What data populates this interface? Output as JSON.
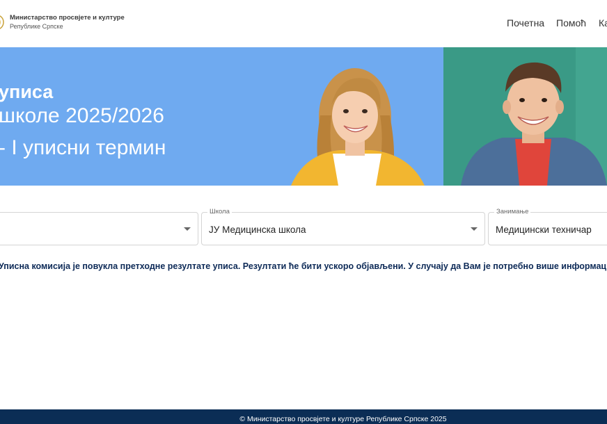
{
  "header": {
    "logo_line1": "Министарство просвјете и културе",
    "logo_line2": "Републике Српске",
    "nav": {
      "home": "Почетна",
      "help": "Помоћ",
      "third": "Ка"
    }
  },
  "hero": {
    "title_line1": "уписа",
    "title_line2": "школе 2025/2026",
    "title_line3": "- I уписни термин"
  },
  "filters": {
    "school": {
      "label": "Школа",
      "value": "ЈУ Медицинска школа"
    },
    "occupation": {
      "label": "Занимање",
      "value": "Медицински техничар"
    }
  },
  "notice": "Уписна комисија је повукла претходне резултате уписа. Резултати ће бити ускоро објављени. У случају да Вам је потребно више информација, ко",
  "footer": {
    "copyright": "© Министарство просвјете и културе Републике Српске 2025"
  },
  "colors": {
    "hero_blue": "#6faaf0",
    "hero_teal": "#3a9a86",
    "notice_text": "#0d2a57",
    "footer_bg": "#0b2d55"
  }
}
